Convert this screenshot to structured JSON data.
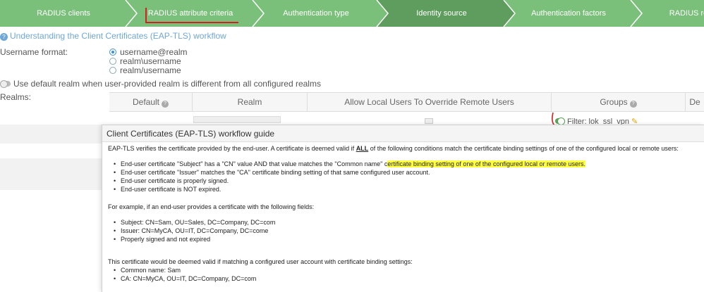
{
  "wizard": {
    "steps": [
      {
        "label": "RADIUS clients"
      },
      {
        "label": "RADIUS attribute criteria"
      },
      {
        "label": "Authentication type"
      },
      {
        "label": "Identity source"
      },
      {
        "label": "Authentication factors"
      },
      {
        "label": "RADIUS re"
      }
    ],
    "active_step": "Identity source"
  },
  "help_link": "Understanding the Client Certificates (EAP-TLS) workflow",
  "username_format": {
    "label": "Username format:",
    "options": [
      "username@realm",
      "realm\\username",
      "realm/username"
    ],
    "selected": "username@realm"
  },
  "default_realm_toggle": "Use default realm when user-provided realm is different from all configured realms",
  "realms": {
    "label": "Realms:",
    "columns": [
      "Default",
      "Realm",
      "Allow Local Users To Override Remote Users",
      "Groups",
      "De"
    ],
    "filter_text": "Filter: lok_ssl_vpn"
  },
  "modal": {
    "title": "Client Certificates (EAP-TLS) workflow guide",
    "intro_a": "EAP-TLS verifies the certificate provided by the end-user. A certificate is deemed valid if ",
    "intro_all": "ALL",
    "intro_b": " of the following conditions match the certificate binding settings of one of the configured local or remote users:",
    "cond1_a": "End-user certificate \"Subject\" has a \"CN\" value AND that value matches the \"Common name\" c",
    "cond1_hl": "ertificate binding setting of one of the configured local or remote users.",
    "cond2": "End-user certificate \"Issuer\" matches the \"CA\" certificate binding setting of that same configured user account.",
    "cond3": "End-user certificate is properly signed.",
    "cond4": "End-user certificate is NOT expired.",
    "example_intro": "For example, if an end-user provides a certificate with the following fields:",
    "ex1": "Subject: CN=Sam, OU=Sales, DC=Company, DC=com",
    "ex2": "Issuer: CN=MyCA, OU=IT, DC=Company, DC=come",
    "ex3": "Properly signed and not expired",
    "valid_intro": "This certificate would be deemed valid if matching a configured user account with certificate binding settings:",
    "b1": "Common name: Sam",
    "b2": "CA: CN=MyCA, OU=IT, DC=Company, DC=com"
  },
  "colors": {
    "steps_bar": "#7ac07a",
    "active_step": "#5f9d5f",
    "link": "#6fa7d8",
    "highlight": "#ffff40",
    "annotation": "#d42020"
  }
}
